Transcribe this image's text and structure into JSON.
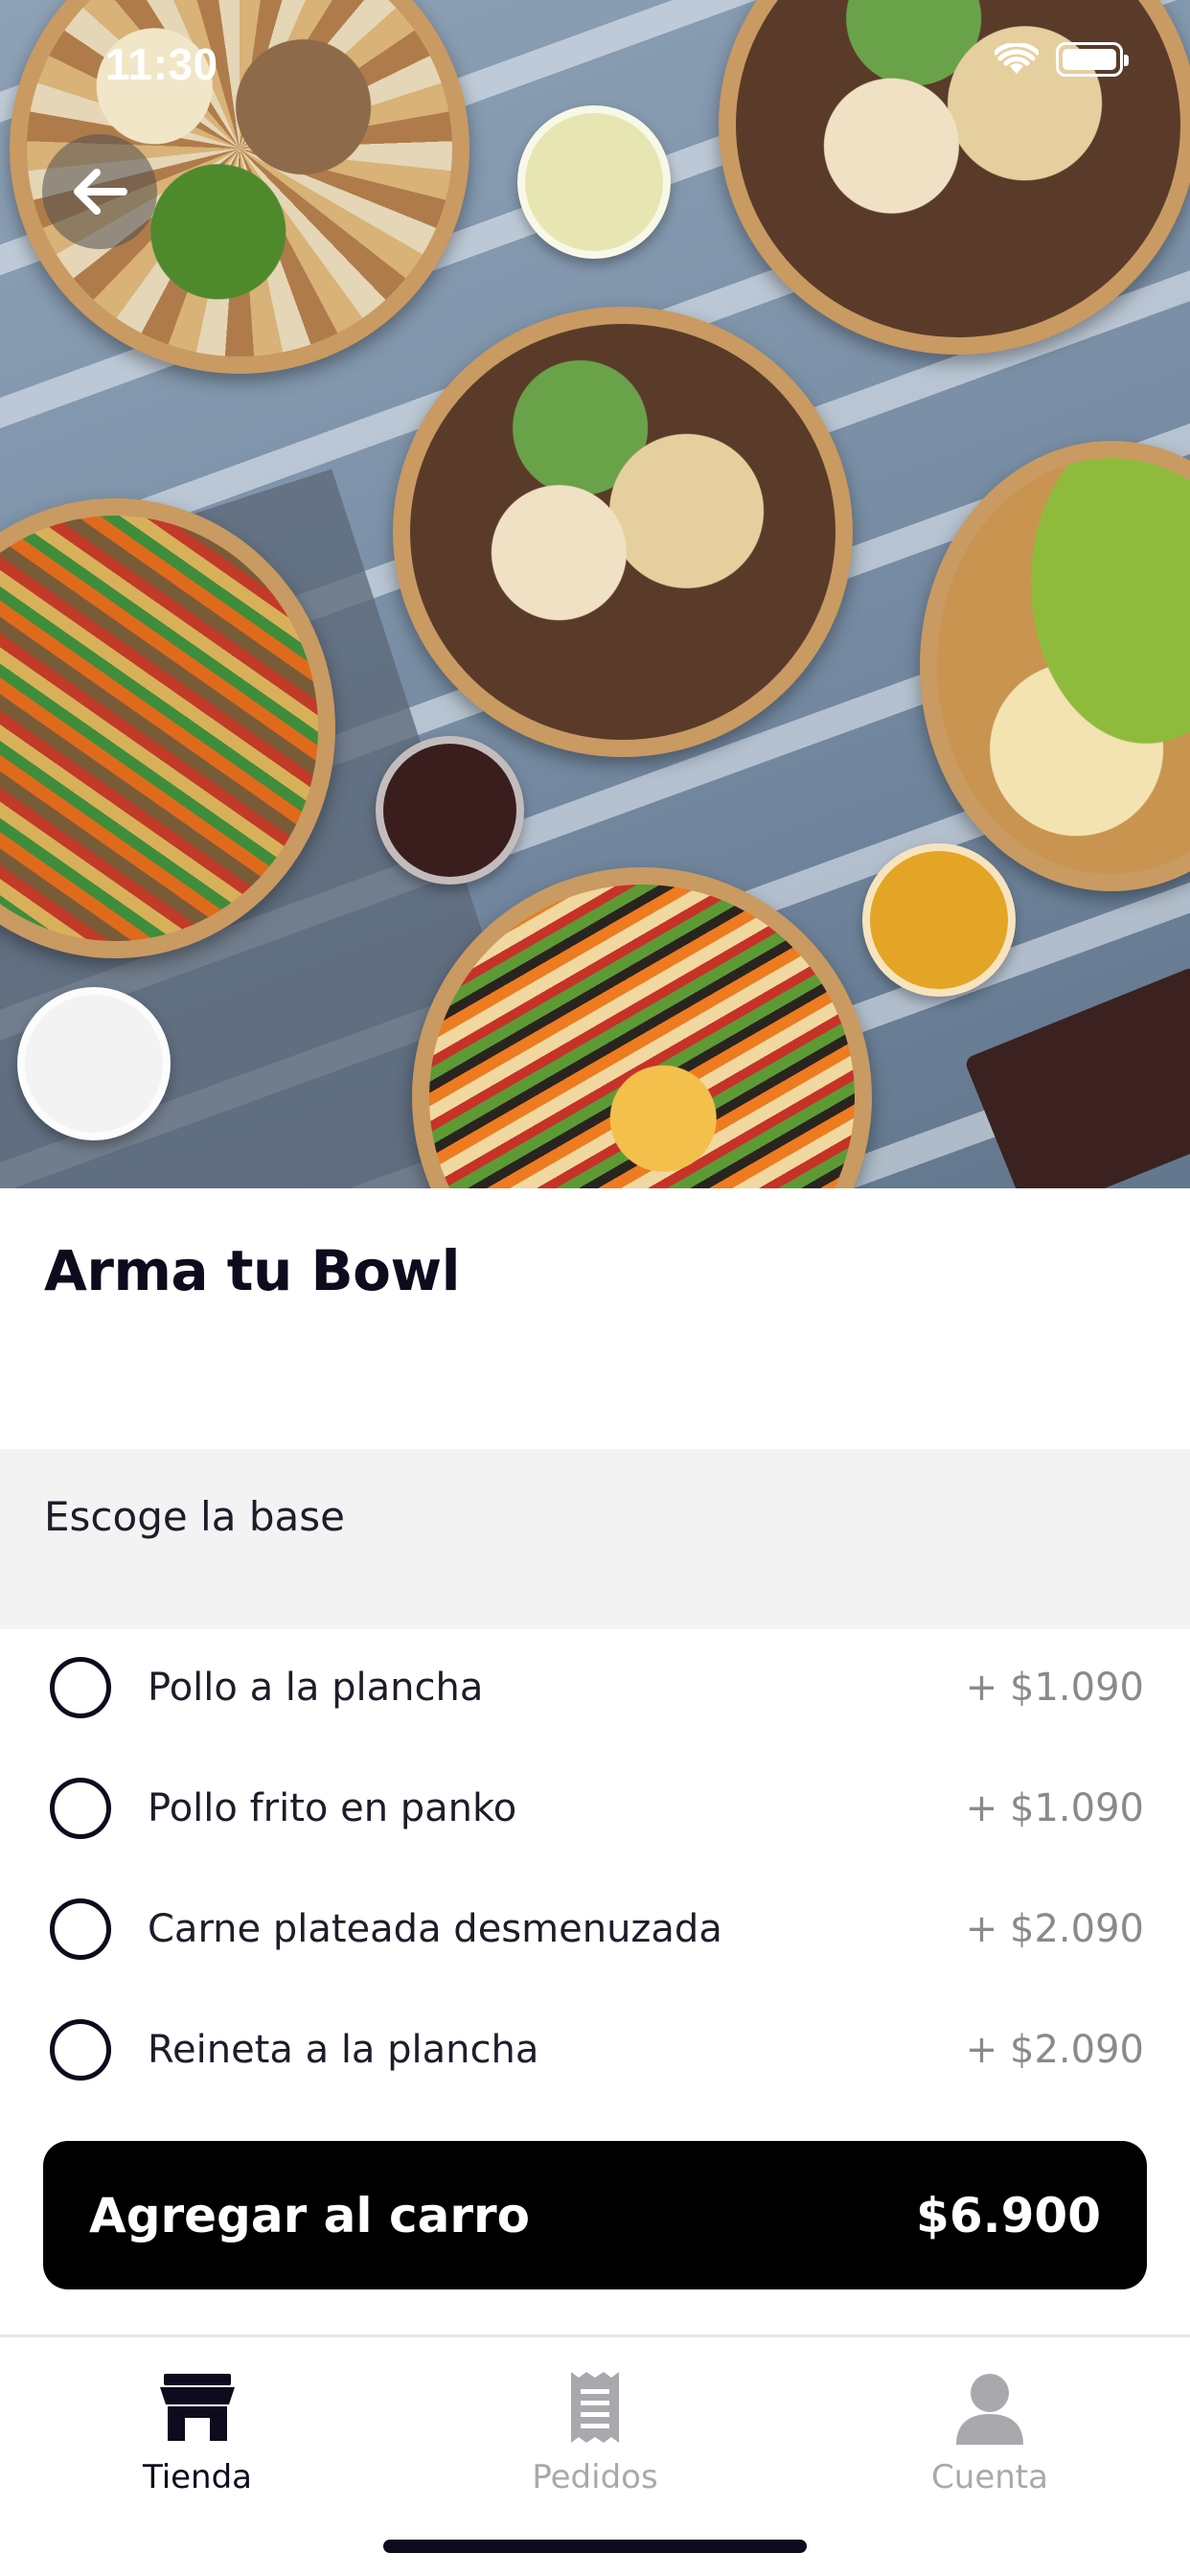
{
  "status_bar": {
    "time": "11:30"
  },
  "product": {
    "title": "Arma tu Bowl"
  },
  "section": {
    "title": "Escoge la base"
  },
  "options": [
    {
      "label": "Pollo a la plancha",
      "price": "+ $1.090"
    },
    {
      "label": "Pollo frito en panko",
      "price": "+ $1.090"
    },
    {
      "label": "Carne plateada desmenuzada",
      "price": "+ $2.090"
    },
    {
      "label": "Reineta a la plancha",
      "price": "+ $2.090"
    }
  ],
  "cta": {
    "label": "Agregar al carro",
    "price": "$6.900"
  },
  "tabs": [
    {
      "label": "Tienda",
      "icon": "store-icon",
      "active": true
    },
    {
      "label": "Pedidos",
      "icon": "receipt-icon",
      "active": false
    },
    {
      "label": "Cuenta",
      "icon": "person-icon",
      "active": false
    }
  ],
  "colors": {
    "primary": "#000000",
    "text": "#0c0c1e",
    "muted": "#8a8a8e",
    "section_bg": "#f3f3f3"
  }
}
